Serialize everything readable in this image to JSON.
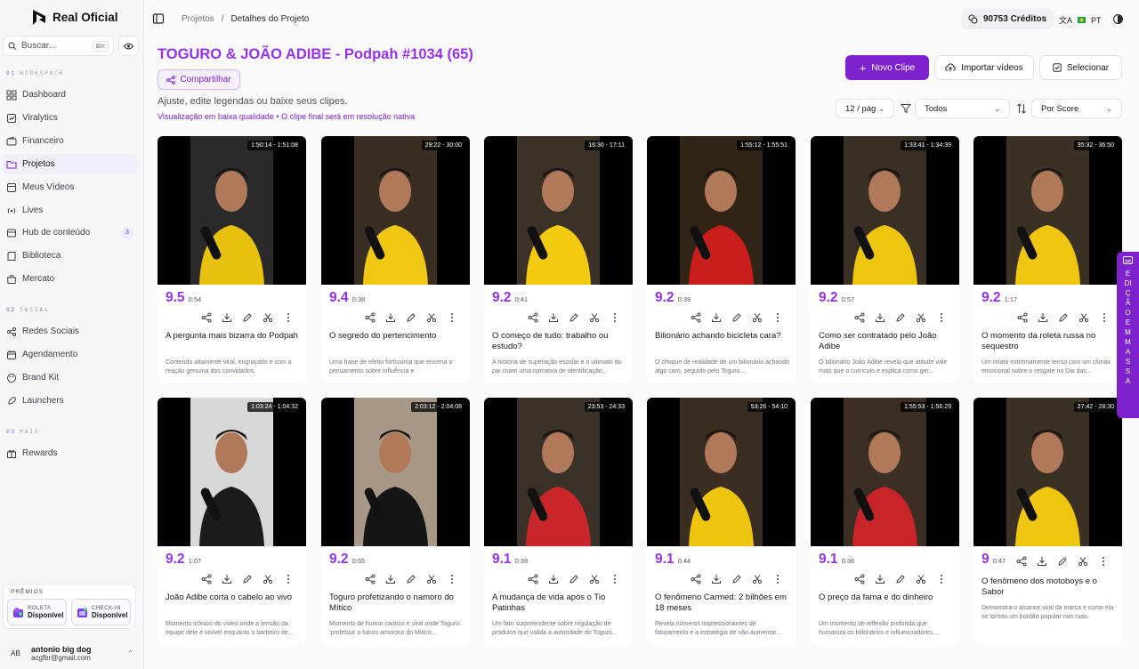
{
  "brand": {
    "name": "Real Oficial"
  },
  "search": {
    "placeholder": "Buscar...",
    "shortcut": "⌘K"
  },
  "sections": [
    {
      "num": "01",
      "label": "WORKSPACE"
    },
    {
      "num": "02",
      "label": "SOCIAL"
    },
    {
      "num": "03",
      "label": "MAIS"
    }
  ],
  "nav": [
    {
      "label": "Dashboard",
      "icon": "grid-icon"
    },
    {
      "label": "Viralytics",
      "icon": "chart-icon"
    },
    {
      "label": "Financeiro",
      "icon": "wallet-icon"
    },
    {
      "label": "Projetos",
      "icon": "folder-icon",
      "active": true
    },
    {
      "label": "Meus Vídeos",
      "icon": "video-icon"
    },
    {
      "label": "Lives",
      "icon": "broadcast-icon"
    },
    {
      "label": "Hub de conteúdo",
      "icon": "hub-icon",
      "badge": "3"
    },
    {
      "label": "Biblioteca",
      "icon": "book-icon"
    },
    {
      "label": "Mercato",
      "icon": "store-icon"
    },
    {
      "label": "Redes Sociais",
      "icon": "share-icon"
    },
    {
      "label": "Agendamento",
      "icon": "calendar-icon"
    },
    {
      "label": "Brand Kit",
      "icon": "palette-icon"
    },
    {
      "label": "Launchers",
      "icon": "rocket-icon"
    },
    {
      "label": "Rewards",
      "icon": "gift-icon"
    }
  ],
  "premios": {
    "title": "PRÊMIOS",
    "cards": [
      {
        "label": "ROLETA",
        "status": "Disponível"
      },
      {
        "label": "CHECK-IN",
        "status": "Disponível"
      }
    ]
  },
  "user": {
    "initials": "AB",
    "name": "antonio big dog",
    "email": "acgfbr@gmail.com"
  },
  "topbar": {
    "breadcrumb": [
      "Projetos",
      "/",
      "Detalhes do Projeto"
    ],
    "credits": "90753 Créditos",
    "lang": "PT"
  },
  "project": {
    "title": "TOGURO & JOÃO ADIBE - Podpah #1034 (65)",
    "share_label": "Compartilhar",
    "subtitle": "Ajuste, edite legendas ou baixe seus clipes.",
    "note": "Visualização em baixa qualidade • O clipe final será em resolução nativa"
  },
  "actions": {
    "new_clip": "Novo Clipe",
    "import": "Importar vídeos",
    "select": "Selecionar"
  },
  "filters": {
    "per_page": "12 / pág",
    "filter": "Todos",
    "sort": "Por Score"
  },
  "side_tab": {
    "label": "EDIÇÃO EM MASSA"
  },
  "clips": [
    {
      "time": "1:50:14 - 1:51:08",
      "score": "9.5",
      "duration": "0:54",
      "title": "A pergunta mais bizarra do Podpah",
      "desc": "Conteúdo altamente viral, engraçado e com a reação genuína dos convidados.",
      "bg": "#2a2a2a",
      "shirt": "#e8c10f"
    },
    {
      "time": "29:22 - 30:00",
      "score": "9.4",
      "duration": "0:38",
      "title": "O segredo do pertencimento",
      "desc": "Uma frase de efeito fortíssima que encerra o pensamento sobre influência e",
      "bg": "#3a2e22",
      "shirt": "#f0c814"
    },
    {
      "time": "16:30 - 17:11",
      "score": "9.2",
      "duration": "0:41",
      "title": "O começo de tudo: trabalho ou estudo?",
      "desc": "A história de superação escolar e o ultimato do pai criam uma narrativa de identificação...",
      "bg": "#3b3126",
      "shirt": "#f2cb10"
    },
    {
      "time": "1:55:12 - 1:55:51",
      "score": "9.2",
      "duration": "0:39",
      "title": "Bilionário achando bicicleta cara?",
      "desc": "O choque de realidade de um bilionário achando algo caro, seguido pelo Toguro...",
      "bg": "#2f2416",
      "shirt": "#c81e1e"
    },
    {
      "time": "1:33:41 - 1:34:39",
      "score": "9.2",
      "duration": "0:57",
      "title": "Como ser contratado pelo João Adibe",
      "desc": "O bilionário João Adibe revela que atitude vale mais que o currículo e explica como ger...",
      "bg": "#3a2f24",
      "shirt": "#efc60f"
    },
    {
      "time": "35:32 - 36:50",
      "score": "9.2",
      "duration": "1:17",
      "title": "O momento da roleta russa no sequestro",
      "desc": "Um relato extremamente tenso com um clímax emocional sobre o resgate no Dia das...",
      "bg": "#3b3024",
      "shirt": "#f0c710"
    },
    {
      "time": "1:03:24 - 1:04:32",
      "score": "9.2",
      "duration": "1:07",
      "title": "João Adibe corta o cabelo ao vivo",
      "desc": "Momento icônico do vídeo onde a tensão da equipe dele é visível enquanto o barbeiro de...",
      "bg": "#d8d8d8",
      "shirt": "#1b1b1b"
    },
    {
      "time": "2:03:12 - 2:04:08",
      "score": "9.2",
      "duration": "0:55",
      "title": "Toguro profetizando o namoro do Mítico",
      "desc": "Momento de humor caótico e viral onde Toguro 'profetiza' o futuro amoroso do Mítico...",
      "bg": "#a89888",
      "shirt": "#151515"
    },
    {
      "time": "23:53 - 24:33",
      "score": "9.1",
      "duration": "0:39",
      "title": "A mudança de vida após o Tio Patinhas",
      "desc": "Um fato surpreendente sobre regulação de produtos que valida a autoridade do Toguro...",
      "bg": "#3a3228",
      "shirt": "#c8262a"
    },
    {
      "time": "53:26 - 54:10",
      "score": "9.1",
      "duration": "0:44",
      "title": "O fenômeno Carmed: 2 bilhões em 18 meses",
      "desc": "Revela números impressionantes de faturamento e a estratégia de não aumentar...",
      "bg": "#3a2e22",
      "shirt": "#efc40e"
    },
    {
      "time": "1:55:53 - 1:56:29",
      "score": "9.1",
      "duration": "0:36",
      "title": "O preço da fama e do dinheiro",
      "desc": "Um momento de reflexão profunda que humaniza os bilionários e influenciadores,...",
      "bg": "#3b2f24",
      "shirt": "#c9242a"
    },
    {
      "time": "27:42 - 28:30",
      "score": "9",
      "duration": "0:47",
      "title": "O fenômeno dos motoboys e o Sabor",
      "desc": "Demonstra o alcance viral da marca e como ela se tornou um bordão popular nas ruas.",
      "bg": "#3b3024",
      "shirt": "#f0c710"
    }
  ],
  "clip_actions": [
    "share-icon",
    "download-icon",
    "edit-icon",
    "cut-icon",
    "more-icon"
  ]
}
